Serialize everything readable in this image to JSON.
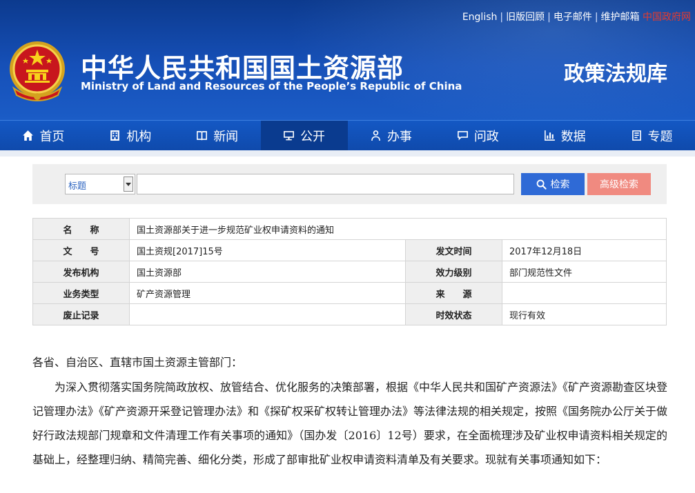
{
  "header": {
    "top_links": [
      "English",
      "旧版回顾",
      "电子邮件",
      "维护邮箱"
    ],
    "gov_link": "中国政府网",
    "site_title_cn": "中华人民共和国国土资源部",
    "site_title_en": "Ministry of Land and Resources of the People’s Republic of China",
    "db_name": "政策法规库"
  },
  "nav": {
    "items": [
      {
        "label": "首页",
        "icon": "home-icon"
      },
      {
        "label": "机构",
        "icon": "org-icon"
      },
      {
        "label": "新闻",
        "icon": "news-icon"
      },
      {
        "label": "公开",
        "icon": "monitor-icon"
      },
      {
        "label": "办事",
        "icon": "user-icon"
      },
      {
        "label": "问政",
        "icon": "chat-icon"
      },
      {
        "label": "数据",
        "icon": "chart-icon"
      },
      {
        "label": "专题",
        "icon": "doc-icon"
      }
    ],
    "active": "公开"
  },
  "search": {
    "field_selected": "标题",
    "input_value": "",
    "search_label": "检索",
    "advanced_label": "高级检索"
  },
  "info": {
    "name_label": "名　　称",
    "name_value": "国土资源部关于进一步规范矿业权申请资料的通知",
    "doc_no_label": "文　　号",
    "doc_no_value": "国土资规[2017]15号",
    "issue_date_label": "发文时间",
    "issue_date_value": "2017年12月18日",
    "issuer_label": "发布机构",
    "issuer_value": "国土资源部",
    "level_label": "效力级别",
    "level_value": "部门规范性文件",
    "category_label": "业务类型",
    "category_value": "矿产资源管理",
    "source_label": "来　　源",
    "source_value": "",
    "repeal_label": "废止记录",
    "repeal_value": "",
    "status_label": "时效状态",
    "status_value": "现行有效"
  },
  "doc": {
    "salutation": "各省、自治区、直辖市国土资源主管部门：",
    "paragraph1": "为深入贯彻落实国务院简政放权、放管结合、优化服务的决策部署，根据《中华人民共和国矿产资源法》《矿产资源勘查区块登记管理办法》《矿产资源开采登记管理办法》和《探矿权采矿权转让管理办法》等法律法规的相关规定，按照《国务院办公厅关于做好行政法规部门规章和文件清理工作有关事项的通知》（国办发〔2016〕12号）要求，在全面梳理涉及矿业权申请资料相关规定的基础上，经整理归纳、精简完善、细化分类，形成了部审批矿业权申请资料清单及有关要求。现就有关事项通知如下："
  },
  "colors": {
    "header_blue": "#1650b8",
    "nav_active": "#0a3b8f",
    "search_button": "#2f6ad6",
    "advanced_button": "#f08a80",
    "gov_link_red": "#e83a2c"
  }
}
